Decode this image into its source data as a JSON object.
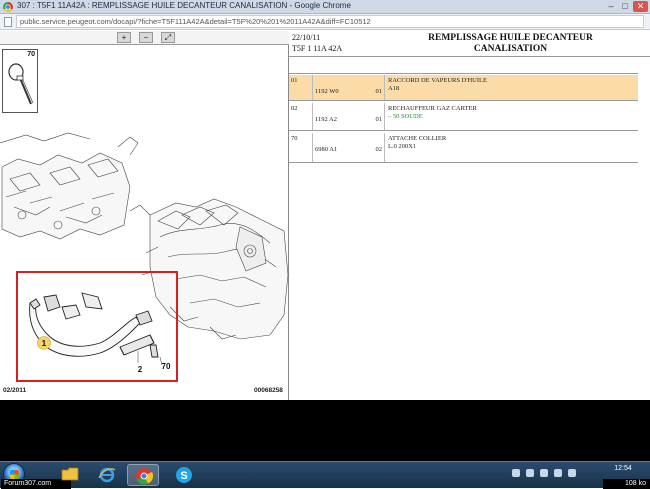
{
  "window": {
    "title": "307 : T5F1 11A42A : REMPLISSAGE HUILE DECANTEUR CANALISATION - Google Chrome",
    "minimize": "–",
    "maximize": "□",
    "close": "✕"
  },
  "address": {
    "url": "public.service.peugeot.com/docapi/?fiche=T5F111A42A&detail=T5F%20%201%2011A42A&diff=FC10512"
  },
  "toolbar": {
    "zoom_in": "+",
    "zoom_out": "−",
    "fit": "⤢"
  },
  "diagram": {
    "part_box_number": "70",
    "callouts": [
      "1",
      "2",
      "70"
    ],
    "date": "02/2011",
    "ref": "00068258"
  },
  "sheet": {
    "date": "22/10/11",
    "code": "T5F 1 11A 42A",
    "title_line1": "REMPLISSAGE HUILE DECANTEUR",
    "title_line2": "CANALISATION"
  },
  "parts": [
    {
      "index": "01",
      "ref": "1192 W0",
      "qty": "01",
      "description": "RACCORD DE VAPEURS D'HUILE",
      "note": "A18",
      "note_color": "#222222",
      "highlight": true
    },
    {
      "index": "02",
      "ref": "1192 A2",
      "qty": "01",
      "description": "RECHAUFFEUR GAZ CARTER",
      "note": "– 50 SOUDE",
      "note_color": "#2c8a2c",
      "highlight": false
    },
    {
      "index": "70",
      "ref": "6980 A1",
      "qty": "02",
      "description": "ATTACHE COLLIER",
      "note": "L.0 200X1",
      "note_color": "#222222",
      "highlight": false
    }
  ],
  "taskbar": {
    "forum_label": "Forum307.com",
    "clock": "12:54",
    "zoom": "108 ko"
  }
}
